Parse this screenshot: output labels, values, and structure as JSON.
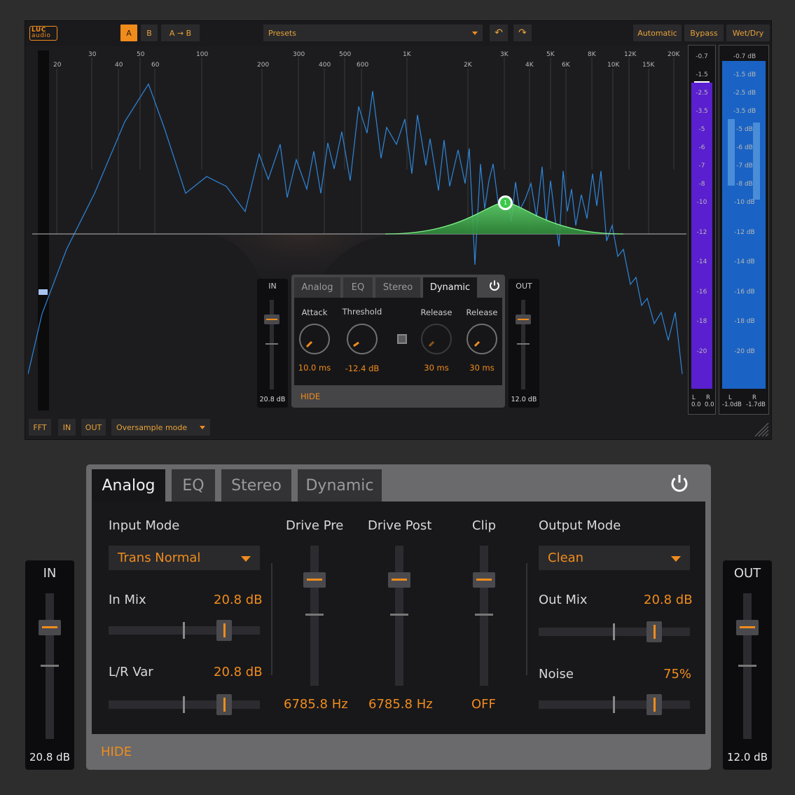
{
  "topbar": {
    "logo_line1": "LUC",
    "logo_line2": "audio",
    "ab_a": "A",
    "ab_b": "B",
    "a_to_b": "A → B",
    "presets_label": "Presets",
    "undo_icon": "↶",
    "redo_icon": "↷",
    "automatic": "Automatic",
    "bypass": "Bypass",
    "wetdry": "Wet/Dry"
  },
  "spectrum": {
    "freq_labels_top": [
      "30",
      "50",
      "100",
      "300",
      "500",
      "1K",
      "3K",
      "5K",
      "8K",
      "12K",
      "20K"
    ],
    "freq_labels_bottom": [
      "20",
      "40",
      "60",
      "200",
      "400",
      "600",
      "2K",
      "4K",
      "6K",
      "10K",
      "15K"
    ],
    "band_number": "1"
  },
  "meters": {
    "left_scale": [
      "-0.7",
      "-1.5",
      "-2.5",
      "-3.5",
      "-5",
      "-6",
      "-7",
      "-8",
      "-10",
      "-12",
      "-14",
      "-16",
      "-18",
      "-20"
    ],
    "right_scale": [
      "-0.7 dB",
      "-1.5 dB",
      "-2.5 dB",
      "-3.5 dB",
      "-5 dB",
      "-6 dB",
      "-7 dB",
      "-8 dB",
      "-10 dB",
      "-12 dB",
      "-14 dB",
      "-16 dB",
      "-18 dB",
      "-20 dB"
    ],
    "left_L": "L",
    "left_R": "R",
    "left_L_val": "0.0",
    "left_R_val": "0.0",
    "right_L": "L",
    "right_R": "R",
    "right_L_val": "-1.0dB",
    "right_R_val": "-1.7dB"
  },
  "small_panel": {
    "in_label": "IN",
    "in_value": "20.8 dB",
    "out_label": "OUT",
    "out_value": "12.0 dB",
    "tabs": [
      "Analog",
      "EQ",
      "Stereo",
      "Dynamic"
    ],
    "active_tab": "Dynamic",
    "knobs": [
      {
        "label": "Attack",
        "value": "10.0 ms"
      },
      {
        "label": "Threshold",
        "value": "-12.4 dB"
      },
      {
        "label": "Release",
        "value": "30 ms"
      },
      {
        "label": "Release",
        "value": "30 ms"
      }
    ],
    "hide": "HIDE"
  },
  "bottombar": {
    "fft": "FFT",
    "in": "IN",
    "out": "OUT",
    "oversample": "Oversample mode"
  },
  "big_panel": {
    "tabs": [
      "Analog",
      "EQ",
      "Stereo",
      "Dynamic"
    ],
    "active_tab": "Analog",
    "input_mode_label": "Input Mode",
    "input_mode_value": "Trans Normal",
    "in_mix_label": "In Mix",
    "in_mix_value": "20.8 dB",
    "lr_var_label": "L/R Var",
    "lr_var_value": "20.8 dB",
    "drive_pre_label": "Drive Pre",
    "drive_pre_value": "6785.8 Hz",
    "drive_post_label": "Drive Post",
    "drive_post_value": "6785.8 Hz",
    "clip_label": "Clip",
    "clip_value": "OFF",
    "output_mode_label": "Output Mode",
    "output_mode_value": "Clean",
    "out_mix_label": "Out Mix",
    "out_mix_value": "20.8 dB",
    "noise_label": "Noise",
    "noise_value": "75%",
    "hide": "HIDE",
    "in_label": "IN",
    "in_value": "20.8 dB",
    "out_label": "OUT",
    "out_value": "12.0 dB"
  },
  "colors": {
    "accent": "#f08c1c",
    "eq_band": "#4ec65a",
    "spectrum_line": "#2f86d8",
    "meter_left": "#5a1fcf",
    "meter_right": "#1a63c4"
  }
}
